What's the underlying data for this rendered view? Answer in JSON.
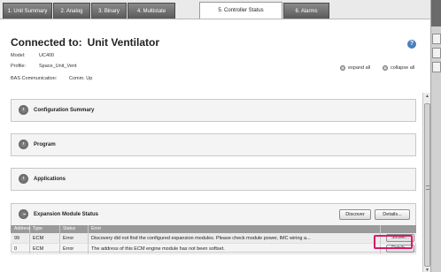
{
  "tabs": [
    {
      "label": "1. Unit Summary",
      "active": false
    },
    {
      "label": "2. Analog",
      "active": false
    },
    {
      "label": "3. Binary",
      "active": false
    },
    {
      "label": "4. Multistate",
      "active": false
    },
    {
      "label": "5. Controller Status",
      "active": true
    },
    {
      "label": "6. Alarms",
      "active": false
    }
  ],
  "header": {
    "connected_label": "Connected to:",
    "device_name": "Unit Ventilator"
  },
  "info": {
    "model_label": "Model:",
    "model_value": "UC400",
    "profile_label": "Profile:",
    "profile_value": "Space_Unit_Vent",
    "bas_label": "BAS Communication:",
    "bas_value": "Comm. Up"
  },
  "controls": {
    "expand_all": "expand all",
    "collapse_all": "collapse all"
  },
  "sections": {
    "configuration_summary": "Configuration Summary",
    "program": "Program",
    "applications": "Applications",
    "expansion_module_status": "Expansion Module Status"
  },
  "expansion": {
    "discover_label": "Discover",
    "details_label": "Details...",
    "columns": [
      "Address",
      "Type",
      "Status",
      "Error"
    ],
    "rows": [
      {
        "address": "99",
        "type": "ECM",
        "status": "Error",
        "error": "Discovery did not find the configured expansion modules.  Please check module power, IMC wiring a...",
        "action": "Softset..."
      },
      {
        "address": "0",
        "type": "ECM",
        "status": "Error",
        "error": "The address of this ECM engine module has not been softset.",
        "action": "Details..."
      }
    ]
  },
  "colors": {
    "tab_inactive": "#5a5a5a",
    "grid_header": "#9a9a9a",
    "highlight": "#d6196a",
    "help_icon": "#4a7ebb"
  },
  "icons": {
    "help": "?",
    "chevron": "›",
    "scroll_up": "▲",
    "scroll_down": "▼"
  }
}
